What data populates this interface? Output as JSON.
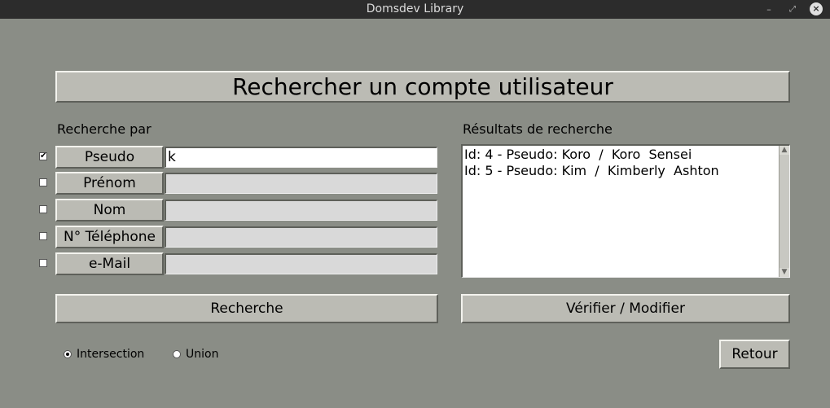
{
  "window": {
    "title": "Domsdev Library",
    "controls": {
      "minimize": "–",
      "maximize": "⤢",
      "close": "×"
    }
  },
  "heading": "Rechercher un compte utilisateur",
  "search_by": {
    "label": "Recherche par",
    "criteria": [
      {
        "label": "Pseudo",
        "checked": true,
        "value": "k"
      },
      {
        "label": "Prénom",
        "checked": false,
        "value": ""
      },
      {
        "label": "Nom",
        "checked": false,
        "value": ""
      },
      {
        "label": "N° Téléphone",
        "checked": false,
        "value": ""
      },
      {
        "label": "e-Mail",
        "checked": false,
        "value": ""
      }
    ]
  },
  "results": {
    "label": "Résultats de recherche",
    "items": [
      "Id: 4 - Pseudo: Koro  /  Koro  Sensei",
      "Id: 5 - Pseudo: Kim  /  Kimberly  Ashton"
    ]
  },
  "buttons": {
    "search": "Recherche",
    "verify": "Vérifier / Modifier",
    "back": "Retour"
  },
  "mode": {
    "options": [
      "Intersection",
      "Union"
    ],
    "selected": "Intersection"
  },
  "icons": {
    "check": "✔",
    "scroll_up": "▲",
    "scroll_down": "▼"
  }
}
